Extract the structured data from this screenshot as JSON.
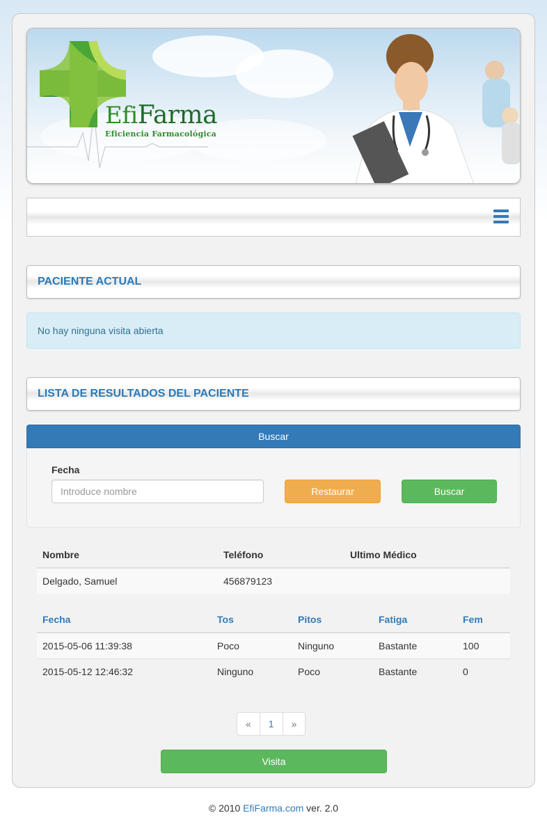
{
  "brand": {
    "name_prefix": "Efi",
    "name_suffix": "Farma",
    "tagline": "Eficiencia Farmacológica"
  },
  "nav": {
    "menu_icon": "hamburger-icon"
  },
  "current_patient": {
    "title": "PACIENTE ACTUAL",
    "message": "No hay ninguna visita abierta"
  },
  "results": {
    "title": "LISTA DE RESULTADOS DEL PACIENTE",
    "search_toggle_label": "Buscar",
    "filter_label": "Fecha",
    "search_placeholder": "Introduce nombre",
    "reset_label": "Restaurar",
    "search_label": "Buscar"
  },
  "patient_table": {
    "headers": [
      "Nombre",
      "Teléfono",
      "Ultimo Médico"
    ],
    "rows": [
      [
        "Delgado, Samuel",
        "456879123",
        ""
      ]
    ]
  },
  "results_table": {
    "headers": [
      "Fecha",
      "Tos",
      "Pitos",
      "Fatiga",
      "Fem"
    ],
    "rows": [
      [
        "2015-05-06 11:39:38",
        "Poco",
        "Ninguno",
        "Bastante",
        "100"
      ],
      [
        "2015-05-12 12:46:32",
        "Ninguno",
        "Poco",
        "Bastante",
        "0"
      ]
    ]
  },
  "pagination": {
    "prev": "«",
    "current": "1",
    "next": "»"
  },
  "visit_button": "Visita",
  "footer": {
    "prefix": "© 2010 ",
    "link": "EfiFarma.com",
    "suffix": " ver. 2.0"
  },
  "colors": {
    "primary": "#337ab7",
    "success": "#5cb85c",
    "warning": "#f0ad4e",
    "info_bg": "#d9edf7",
    "brand_green": "#2f8c2a"
  }
}
